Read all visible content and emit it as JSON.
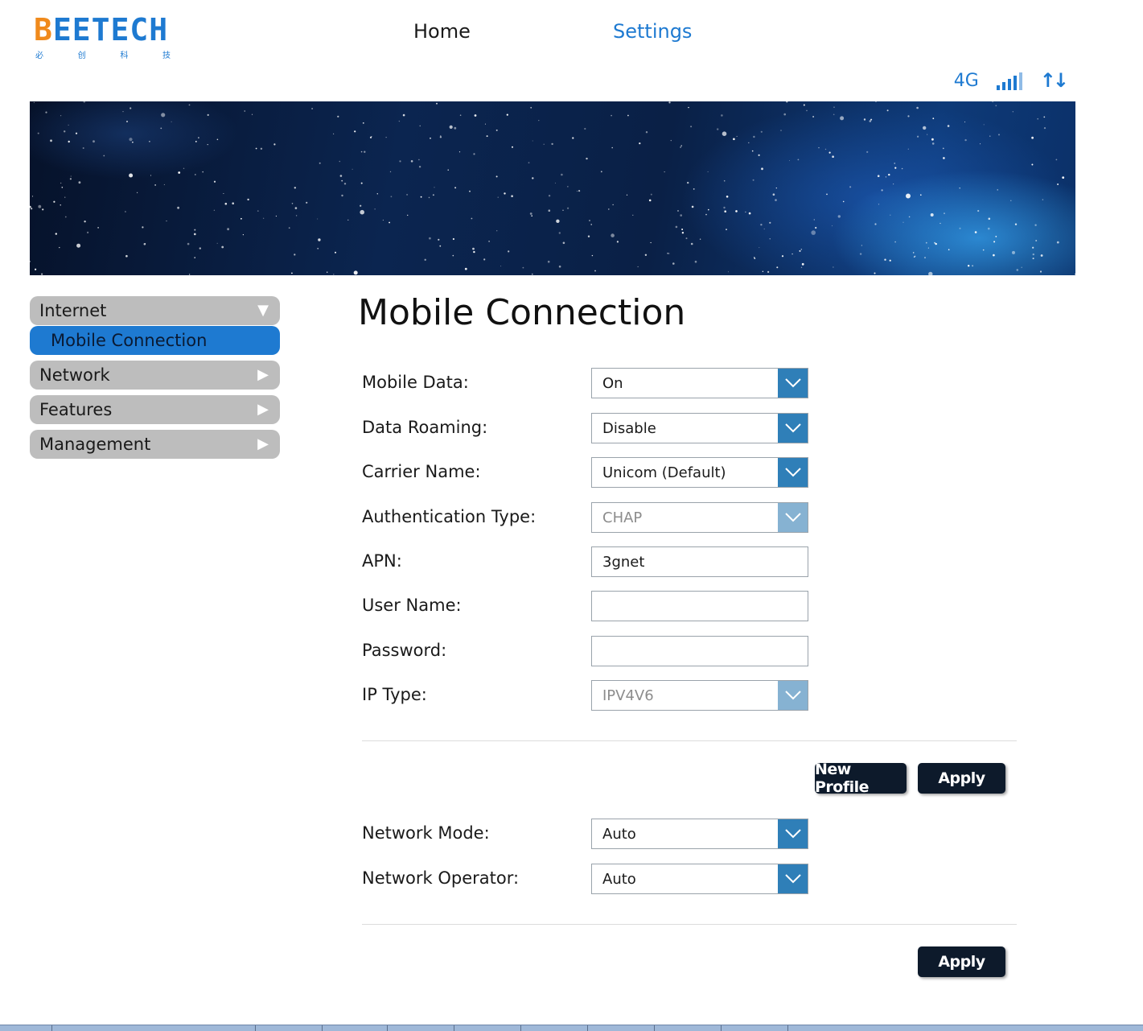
{
  "header": {
    "logo_text_first": "B",
    "logo_text_rest": "EETECH",
    "logo_sub": [
      "必",
      "创",
      "科",
      "技"
    ],
    "nav": {
      "home": "Home",
      "settings": "Settings"
    },
    "status": {
      "network_type": "4G",
      "signal_icon": "signal-bars-icon",
      "data_icon": "data-transfer-icon",
      "arrows": "↑↓"
    }
  },
  "sidebar": {
    "items": [
      {
        "label": "Internet",
        "expanded": true,
        "sub": [
          {
            "label": "Mobile Connection",
            "active": true
          }
        ]
      },
      {
        "label": "Network"
      },
      {
        "label": "Features"
      },
      {
        "label": "Management"
      }
    ]
  },
  "main": {
    "title": "Mobile Connection",
    "fields": {
      "mobile_data": {
        "label": "Mobile Data:",
        "value": "On"
      },
      "data_roaming": {
        "label": "Data Roaming:",
        "value": "Disable"
      },
      "carrier_name": {
        "label": "Carrier Name:",
        "value": "Unicom (Default)"
      },
      "auth_type": {
        "label": "Authentication Type:",
        "value": "CHAP"
      },
      "apn": {
        "label": "APN:",
        "value": "3gnet"
      },
      "user_name": {
        "label": "User Name:",
        "value": ""
      },
      "password": {
        "label": "Password:",
        "value": ""
      },
      "ip_type": {
        "label": "IP Type:",
        "value": "IPV4V6"
      },
      "network_mode": {
        "label": "Network Mode:",
        "value": "Auto"
      },
      "network_operator": {
        "label": "Network Operator:",
        "value": "Auto"
      }
    },
    "buttons": {
      "new_profile": "New Profile",
      "apply": "Apply",
      "apply2": "Apply"
    }
  },
  "colors": {
    "accent": "#1e7ad1",
    "logo_orange": "#f08a1c",
    "chevron": "#2f7fb8",
    "button": "#0d1a2b",
    "sidebar_item": "#bdbdbd"
  }
}
